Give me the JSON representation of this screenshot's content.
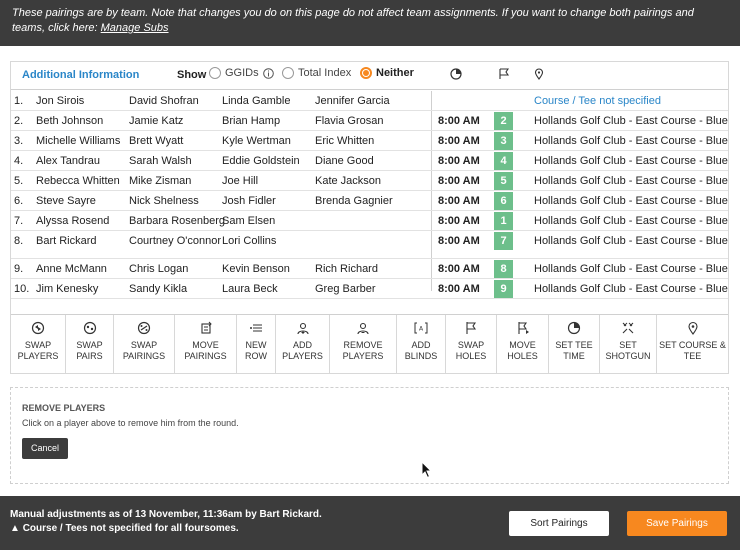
{
  "notice": {
    "text": "These pairings are by team. Note that changes you do on this page do not affect team assignments. If you want to change both pairings and teams, click here: ",
    "link": "Manage Subs"
  },
  "info_header": {
    "title": "Additional Information",
    "show_label": "Show",
    "options": [
      "GGIDs",
      "Total Index",
      "Neither"
    ],
    "selected": "Neither"
  },
  "rows": [
    {
      "num": "1.",
      "players": [
        "Jon Sirois",
        "David Shofran",
        "Linda Gamble",
        "Jennifer Garcia"
      ],
      "time": "",
      "hole": "",
      "course": "Course / Tee not specified"
    },
    {
      "num": "2.",
      "players": [
        "Beth Johnson",
        "Jamie Katz",
        "Brian Hamp",
        "Flavia Grosan"
      ],
      "time": "8:00 AM",
      "hole": "2",
      "course": "Hollands Golf Club - East Course - Blue"
    },
    {
      "num": "3.",
      "players": [
        "Michelle Williams",
        "Brett Wyatt",
        "Kyle Wertman",
        "Eric Whitten"
      ],
      "time": "8:00 AM",
      "hole": "3",
      "course": "Hollands Golf Club - East Course - Blue"
    },
    {
      "num": "4.",
      "players": [
        "Alex Tandrau",
        "Sarah Walsh",
        "Eddie Goldstein",
        "Diane Good"
      ],
      "time": "8:00 AM",
      "hole": "4",
      "course": "Hollands Golf Club - East Course - Blue"
    },
    {
      "num": "5.",
      "players": [
        "Rebecca Whitten",
        "Mike Zisman",
        "Joe Hill",
        "Kate Jackson"
      ],
      "time": "8:00 AM",
      "hole": "5",
      "course": "Hollands Golf Club - East Course - Blue"
    },
    {
      "num": "6.",
      "players": [
        "Steve Sayre",
        "Nick Shelness",
        "Josh Fidler",
        "Brenda Gagnier"
      ],
      "time": "8:00 AM",
      "hole": "6",
      "course": "Hollands Golf Club - East Course - Blue"
    },
    {
      "num": "7.",
      "players": [
        "Alyssa Rosend",
        "Barbara Rosenberg",
        "Sam Elsen",
        ""
      ],
      "time": "8:00 AM",
      "hole": "1",
      "course": "Hollands Golf Club - East Course - Blue"
    },
    {
      "num": "8.",
      "players": [
        "Bart Rickard",
        "Courtney O'connor",
        "Lori Collins",
        ""
      ],
      "time": "8:00 AM",
      "hole": "7",
      "course": "Hollands Golf Club - East Course - Blue"
    },
    {
      "num": "9.",
      "players": [
        "Anne McMann",
        "Chris Logan",
        "Kevin Benson",
        "Rich Richard"
      ],
      "time": "8:00 AM",
      "hole": "8",
      "course": "Hollands Golf Club - East Course - Blue"
    },
    {
      "num": "10.",
      "players": [
        "Jim Kenesky",
        "Sandy Kikla",
        "Laura Beck",
        "Greg Barber"
      ],
      "time": "8:00 AM",
      "hole": "9",
      "course": "Hollands Golf Club - East Course - Blue"
    }
  ],
  "toolbar": [
    {
      "icon": "swap-players-icon",
      "l1": "SWAP",
      "l2": "PLAYERS"
    },
    {
      "icon": "swap-pairs-icon",
      "l1": "SWAP",
      "l2": "PAIRS"
    },
    {
      "icon": "swap-pairings-icon",
      "l1": "SWAP",
      "l2": "PAIRINGS"
    },
    {
      "icon": "move-pairings-icon",
      "l1": "MOVE",
      "l2": "PAIRINGS"
    },
    {
      "icon": "new-row-icon",
      "l1": "NEW",
      "l2": "ROW"
    },
    {
      "icon": "add-players-icon",
      "l1": "ADD",
      "l2": "PLAYERS"
    },
    {
      "icon": "remove-players-icon",
      "l1": "REMOVE",
      "l2": "PLAYERS"
    },
    {
      "icon": "add-blinds-icon",
      "l1": "ADD",
      "l2": "BLINDS"
    },
    {
      "icon": "swap-holes-icon",
      "l1": "SWAP",
      "l2": "HOLES"
    },
    {
      "icon": "move-holes-icon",
      "l1": "MOVE",
      "l2": "HOLES"
    },
    {
      "icon": "set-tee-time-icon",
      "l1": "SET TEE",
      "l2": "TIME"
    },
    {
      "icon": "set-shotgun-icon",
      "l1": "SET",
      "l2": "SHOTGUN"
    },
    {
      "icon": "set-course-tee-icon",
      "l1": "SET COURSE &",
      "l2": "TEE"
    }
  ],
  "remove_panel": {
    "title": "REMOVE PLAYERS",
    "description": "Click on a player above to remove him from the round.",
    "cancel_label": "Cancel"
  },
  "footer": {
    "adjustment_text": "Manual adjustments as of 13 November, 11:36am by Bart Rickard.",
    "warning_text": "Course / Tees not specified for all foursomes.",
    "sort_label": "Sort Pairings",
    "save_label": "Save Pairings"
  },
  "colors": {
    "accent": "#f7881f",
    "link": "#2a86c8",
    "hole_badge": "#6dbf8b",
    "dark_bar": "#3c3c3c"
  }
}
